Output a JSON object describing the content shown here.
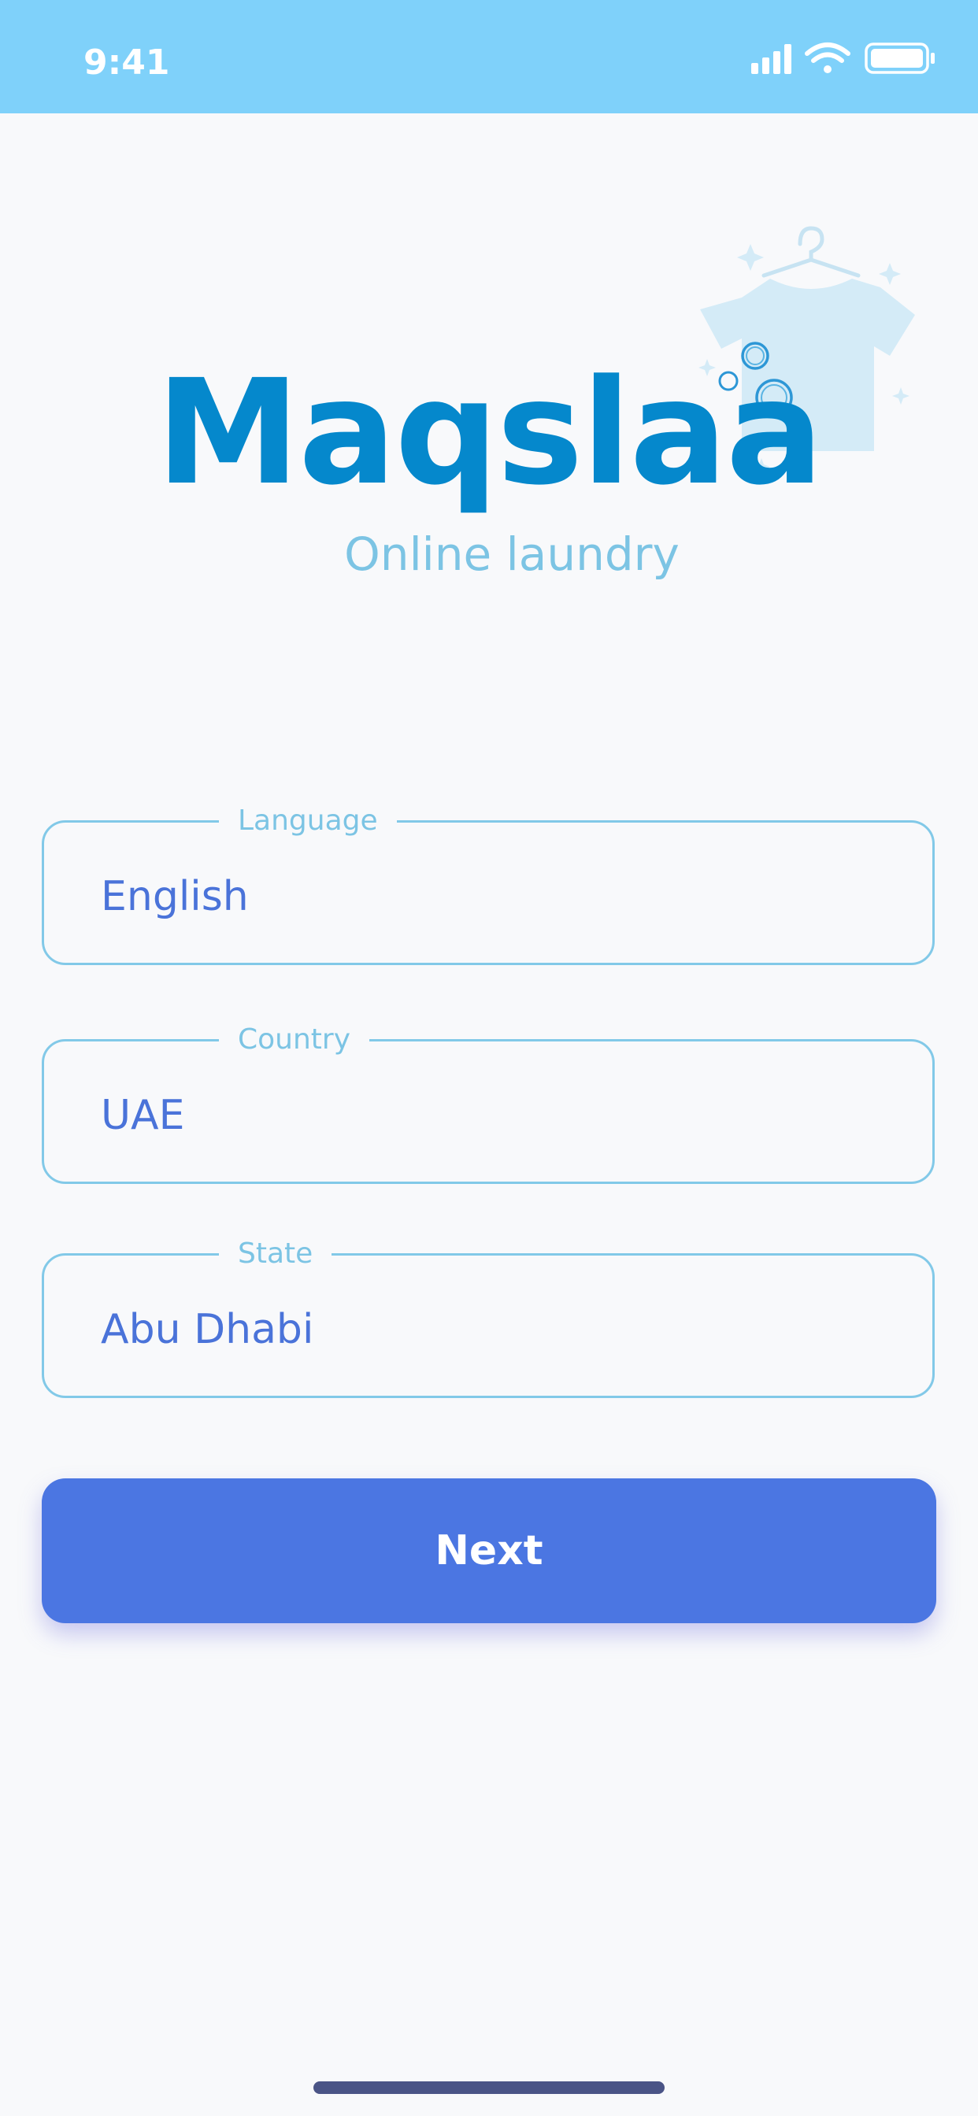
{
  "status_bar": {
    "time": "9:41",
    "background": "#7fd1fa",
    "icons": [
      "signal-icon",
      "wifi-icon",
      "battery-icon"
    ]
  },
  "brand": {
    "name": "Maqslaa",
    "subtitle": "Online laundry",
    "color": "#0588cc",
    "subtitle_color": "#7cc4e4",
    "illustration": "laundry-shirt-icon"
  },
  "form": {
    "fields": [
      {
        "label": "Language",
        "value": "English"
      },
      {
        "label": "Country",
        "value": "UAE"
      },
      {
        "label": "State",
        "value": "Abu Dhabi"
      }
    ],
    "border_color": "#82c9e8",
    "value_color": "#4a73d9"
  },
  "next_button": {
    "label": "Next",
    "background": "#4b76e2"
  }
}
